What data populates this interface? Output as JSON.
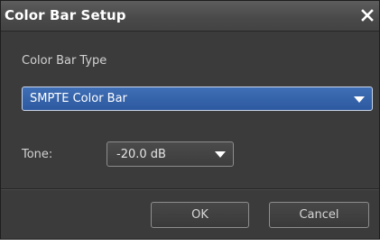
{
  "window": {
    "title": "Color Bar Setup",
    "close_icon": "close-icon"
  },
  "color_bar_type": {
    "label": "Color Bar Type",
    "selected": "SMPTE Color Bar",
    "accent": "#3a64ad"
  },
  "tone": {
    "label": "Tone:",
    "selected": "-20.0 dB"
  },
  "buttons": {
    "ok": "OK",
    "cancel": "Cancel"
  }
}
